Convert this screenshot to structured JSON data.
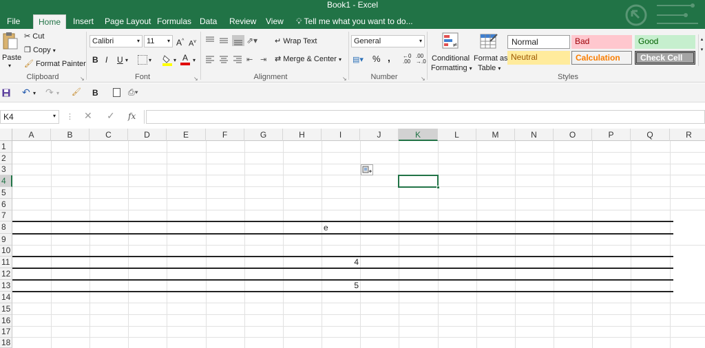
{
  "title": "Book1 - Excel",
  "tabs": [
    "File",
    "Home",
    "Insert",
    "Page Layout",
    "Formulas",
    "Data",
    "Review",
    "View"
  ],
  "tell_me": "Tell me what you want to do...",
  "clipboard": {
    "paste": "Paste",
    "cut": "Cut",
    "copy": "Copy",
    "format_painter": "Format Painter",
    "label": "Clipboard"
  },
  "font": {
    "name": "Calibri",
    "size": "11",
    "bold": "B",
    "italic": "I",
    "underline": "U",
    "label": "Font"
  },
  "alignment": {
    "wrap_text": "Wrap Text",
    "merge_center": "Merge & Center",
    "label": "Alignment"
  },
  "number": {
    "format": "General",
    "percent": "%",
    "comma": ",",
    "label": "Number"
  },
  "styles": {
    "conditional_formatting_1": "Conditional",
    "conditional_formatting_2": "Formatting",
    "format_as_table_1": "Format as",
    "format_as_table_2": "Table",
    "normal": "Normal",
    "bad": "Bad",
    "good": "Good",
    "neutral": "Neutral",
    "calculation": "Calculation",
    "check_cell": "Check Cell",
    "label": "Styles"
  },
  "qat": {
    "bold": "B"
  },
  "formula_bar": {
    "name_box": "K4",
    "fx": "fx",
    "formula": ""
  },
  "columns": [
    "A",
    "B",
    "C",
    "D",
    "E",
    "F",
    "G",
    "H",
    "I",
    "J",
    "K",
    "L",
    "M",
    "N",
    "O",
    "P",
    "Q",
    "R"
  ],
  "rows": [
    "1",
    "2",
    "3",
    "4",
    "5",
    "6",
    "7",
    "8",
    "9",
    "10",
    "11",
    "12",
    "13",
    "14",
    "15",
    "16",
    "17",
    "18"
  ],
  "cells": {
    "I8": "e",
    "I11": "4",
    "I13": "5"
  },
  "colors": {
    "accent": "#217346",
    "bad_bg": "#ffc7ce",
    "bad_fg": "#9c0006",
    "good_bg": "#c6efce",
    "good_fg": "#006100",
    "neutral_bg": "#ffeb9c",
    "neutral_fg": "#9c5700",
    "calc_fg": "#fa7d00",
    "check_bg": "#a5a5a5"
  }
}
